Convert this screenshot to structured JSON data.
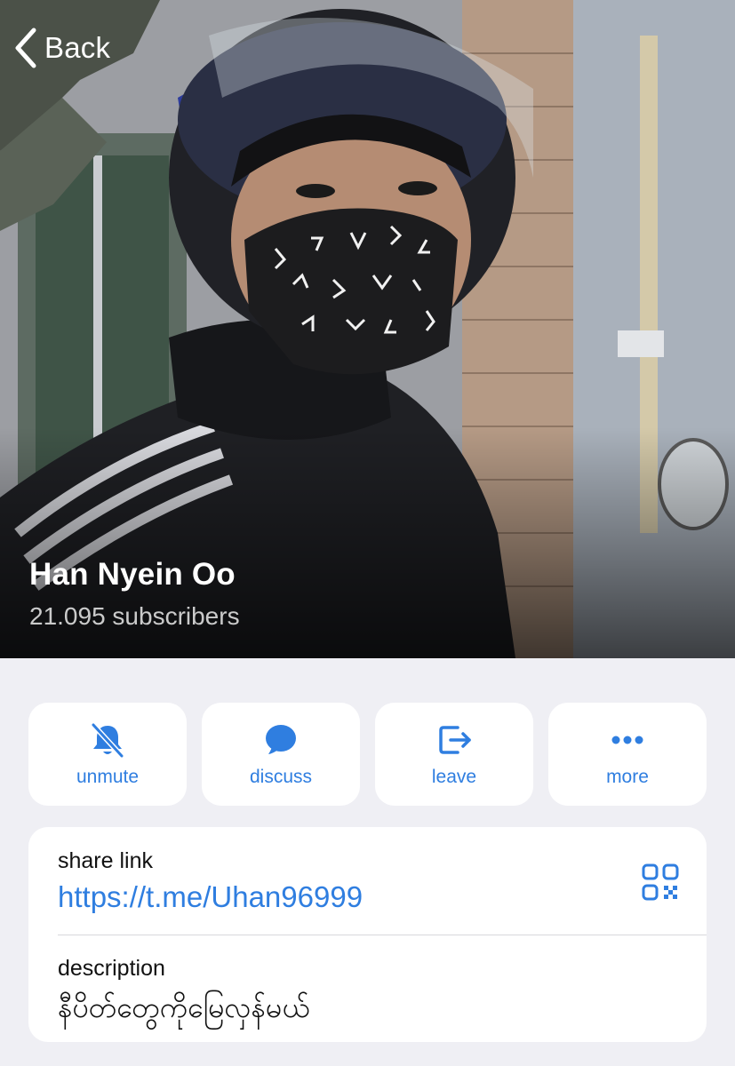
{
  "nav": {
    "back_label": "Back"
  },
  "channel": {
    "title": "Han Nyein Oo",
    "subscribers": "21.095 subscribers"
  },
  "actions": [
    {
      "label": "unmute",
      "icon": "bell-slash-icon"
    },
    {
      "label": "discuss",
      "icon": "chat-bubble-icon"
    },
    {
      "label": "leave",
      "icon": "leave-door-icon"
    },
    {
      "label": "more",
      "icon": "ellipsis-icon"
    }
  ],
  "info": {
    "share_caption": "share link",
    "share_link": "https://t.me/Uhan96999",
    "qr_icon": "qr-code-icon",
    "description_caption": "description",
    "description": "နီပိတ်တွေကိုမြေလှန်မယ်"
  },
  "colors": {
    "accent": "#2f7ee0",
    "background": "#efeff4",
    "card": "#ffffff"
  }
}
